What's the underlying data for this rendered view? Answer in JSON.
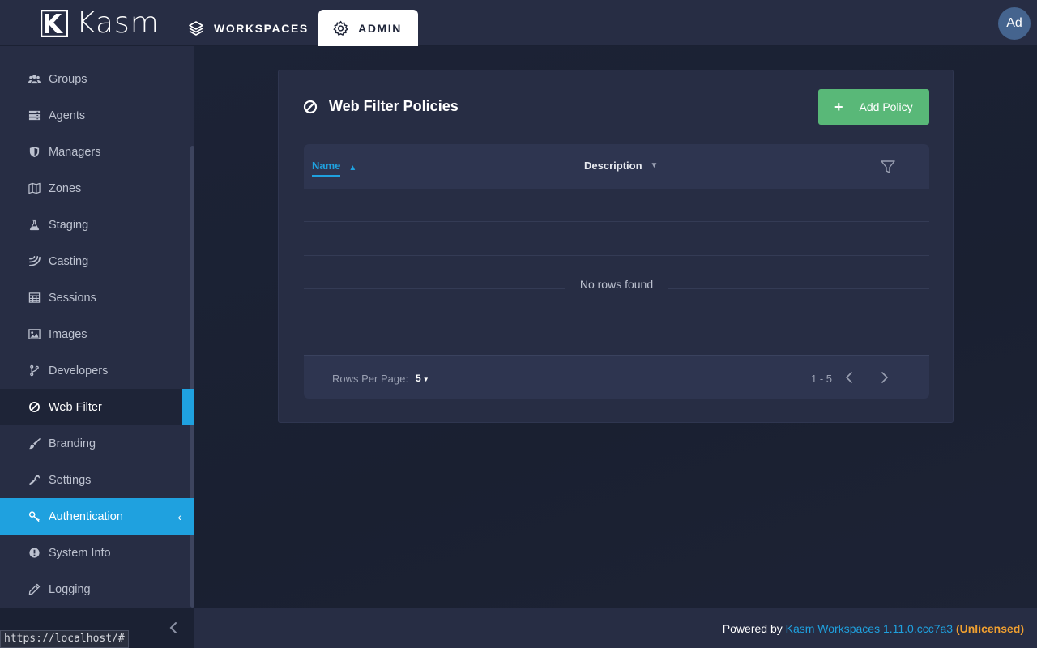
{
  "app": {
    "logo_text": "Kasm",
    "avatar_initials": "Ad"
  },
  "nav": {
    "tabs": [
      {
        "label": "WORKSPACES",
        "icon": "layers-icon",
        "active": false
      },
      {
        "label": "ADMIN",
        "icon": "gear-icon",
        "active": true
      }
    ]
  },
  "sidebar": {
    "items": [
      {
        "label": "Groups",
        "icon": "users-icon"
      },
      {
        "label": "Agents",
        "icon": "server-icon"
      },
      {
        "label": "Managers",
        "icon": "shield-icon"
      },
      {
        "label": "Zones",
        "icon": "map-icon"
      },
      {
        "label": "Staging",
        "icon": "flask-icon"
      },
      {
        "label": "Casting",
        "icon": "broadcast-icon"
      },
      {
        "label": "Sessions",
        "icon": "table-icon"
      },
      {
        "label": "Images",
        "icon": "image-icon"
      },
      {
        "label": "Developers",
        "icon": "branch-icon"
      },
      {
        "label": "Web Filter",
        "icon": "ban-icon",
        "state": "selected"
      },
      {
        "label": "Branding",
        "icon": "brush-icon"
      },
      {
        "label": "Settings",
        "icon": "wrench-icon"
      },
      {
        "label": "Authentication",
        "icon": "key-icon",
        "state": "active"
      },
      {
        "label": "System Info",
        "icon": "info-icon"
      },
      {
        "label": "Logging",
        "icon": "pencil-icon"
      }
    ]
  },
  "page": {
    "title": "Web Filter Policies",
    "add_button_label": "Add Policy",
    "table": {
      "columns": [
        "Name",
        "Description"
      ],
      "sort_column": "Name",
      "empty_message": "No rows found",
      "rows_per_page_label": "Rows Per Page:",
      "rows_per_page_value": "5",
      "range": "1 - 5"
    }
  },
  "footer": {
    "powered_by": "Powered by",
    "product": "Kasm Workspaces 1.11.0.ccc7a3",
    "license": "(Unlicensed)"
  },
  "status_url": "https://localhost/#",
  "colors": {
    "accent": "#1fa1df",
    "add_button": "#59b878",
    "license": "#f0a030"
  }
}
